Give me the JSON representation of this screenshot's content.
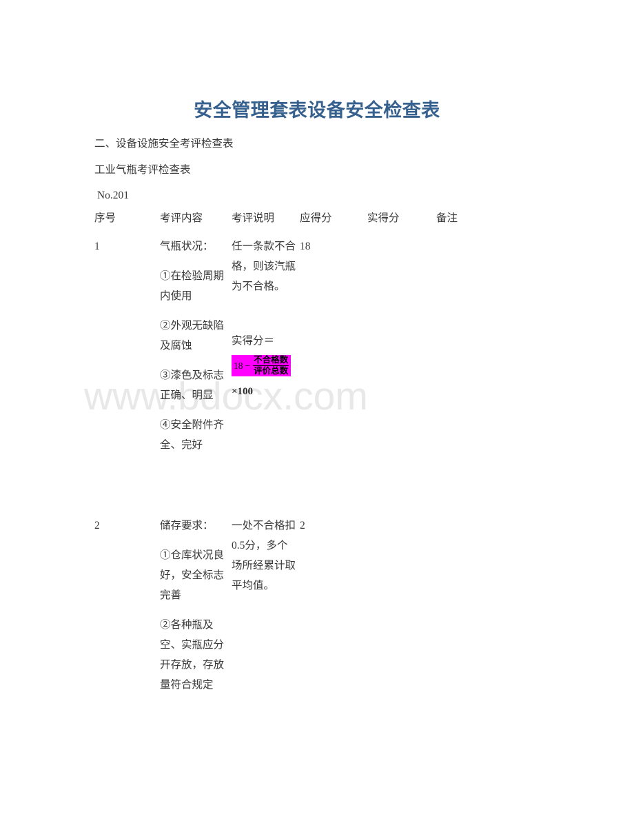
{
  "document": {
    "title": "安全管理套表设备安全检查表",
    "title_color": "#36618E",
    "section_heading": "二、设备设施安全考评检查表",
    "form_name": "工业气瓶考评检查表",
    "form_number": " No.201"
  },
  "watermark": {
    "text": "www.bdocx.com",
    "color": "#E8E8E8"
  },
  "table": {
    "headers": {
      "seq": "序号",
      "item": "考评内容",
      "desc": "考评说明",
      "max_score": "应得分",
      "actual_score": "实得分",
      "note": "备注"
    },
    "rows": [
      {
        "seq": "1",
        "item_title": "气瓶状况：",
        "item_points": [
          "①在检验周期内使用",
          "②外观无缺陷及腐蚀",
          "③漆色及标志正确、明显",
          "④安全附件齐全、完好"
        ],
        "desc_text": "任一条款不合格，则该汽瓶为不合格。",
        "formula": {
          "lead": "实得分＝",
          "base": "18",
          "operator": "−",
          "numerator": "不合格数",
          "denominator": "评价总数",
          "tail": "×100",
          "highlight_color": "#FF00FF"
        },
        "max_score": "18",
        "actual_score": "",
        "note": ""
      },
      {
        "seq": "2",
        "item_title": "储存要求：",
        "item_points": [
          "①仓库状况良好，安全标志完善",
          "②各种瓶及空、实瓶应分开存放，存放量符合规定"
        ],
        "desc_text": "一处不合格扣0.5分，多个场所经累计取平均值。",
        "max_score": "2",
        "actual_score": "",
        "note": ""
      }
    ]
  }
}
